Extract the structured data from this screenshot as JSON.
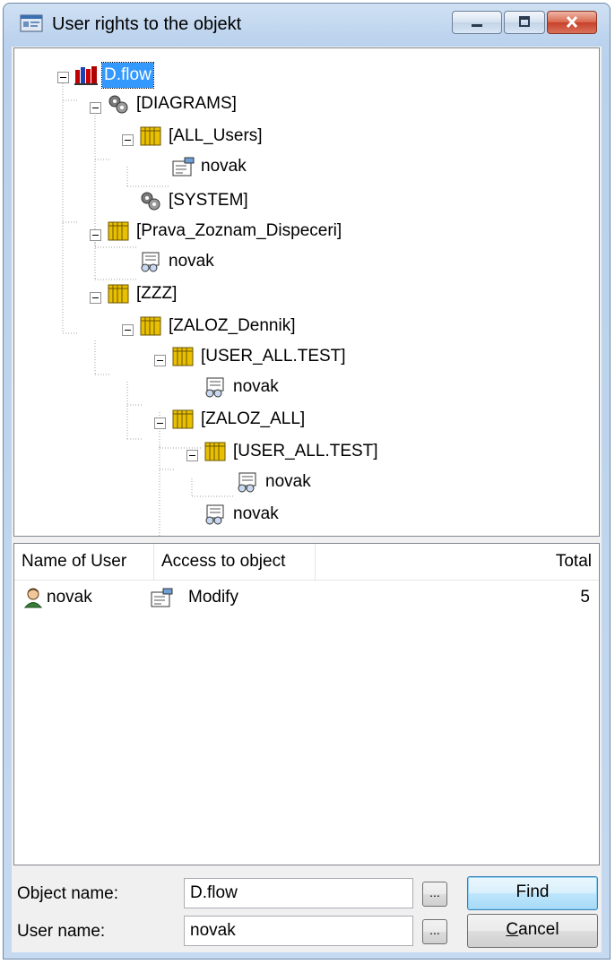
{
  "window": {
    "title": "User rights to the objekt"
  },
  "tree": {
    "nodes": [
      {
        "id": "root",
        "label": "D.flow",
        "icon": "database-books-icon",
        "selected": true
      },
      {
        "id": "diagrams",
        "label": "[DIAGRAMS]",
        "icon": "gears-icon"
      },
      {
        "id": "all-users",
        "label": "[ALL_Users]",
        "icon": "books-folder-icon"
      },
      {
        "id": "all-users-novak",
        "label": "novak",
        "icon": "modify-rights-icon"
      },
      {
        "id": "system",
        "label": "[SYSTEM]",
        "icon": "gears-icon"
      },
      {
        "id": "prava",
        "label": "[Prava_Zoznam_Dispeceri]",
        "icon": "books-folder-icon"
      },
      {
        "id": "prava-novak",
        "label": "novak",
        "icon": "read-rights-icon"
      },
      {
        "id": "zzz",
        "label": "[ZZZ]",
        "icon": "books-folder-icon"
      },
      {
        "id": "zaloz-dennik",
        "label": "[ZALOZ_Dennik]",
        "icon": "books-folder-icon"
      },
      {
        "id": "user-all-test-1",
        "label": "[USER_ALL.TEST]",
        "icon": "books-folder-icon"
      },
      {
        "id": "user-all-test-1-novak",
        "label": "novak",
        "icon": "read-rights-icon"
      },
      {
        "id": "zaloz-all",
        "label": "[ZALOZ_ALL]",
        "icon": "books-folder-icon"
      },
      {
        "id": "user-all-test-2",
        "label": "[USER_ALL.TEST]",
        "icon": "books-folder-icon"
      },
      {
        "id": "user-all-test-2-novak",
        "label": "novak",
        "icon": "read-rights-icon"
      },
      {
        "id": "zaloz-dennik-novak",
        "label": "novak",
        "icon": "read-rights-icon"
      }
    ]
  },
  "list": {
    "columns": [
      "Name of User",
      "Access to object",
      "Total"
    ],
    "rows": [
      {
        "user": "novak",
        "user_icon": "user-icon",
        "access": "Modify",
        "access_icon": "modify-rights-icon",
        "total": "5"
      }
    ]
  },
  "form": {
    "object_name_label": "Object name:",
    "object_name_value": "D.flow",
    "user_name_label": "User name:",
    "user_name_value": "novak",
    "browse_label": "...",
    "find_label": "Find",
    "cancel_label": "Cancel"
  },
  "colors": {
    "selection": "#3399ff",
    "folder_yellow": "#e8c000",
    "window_frame": "#bcd3ee"
  }
}
